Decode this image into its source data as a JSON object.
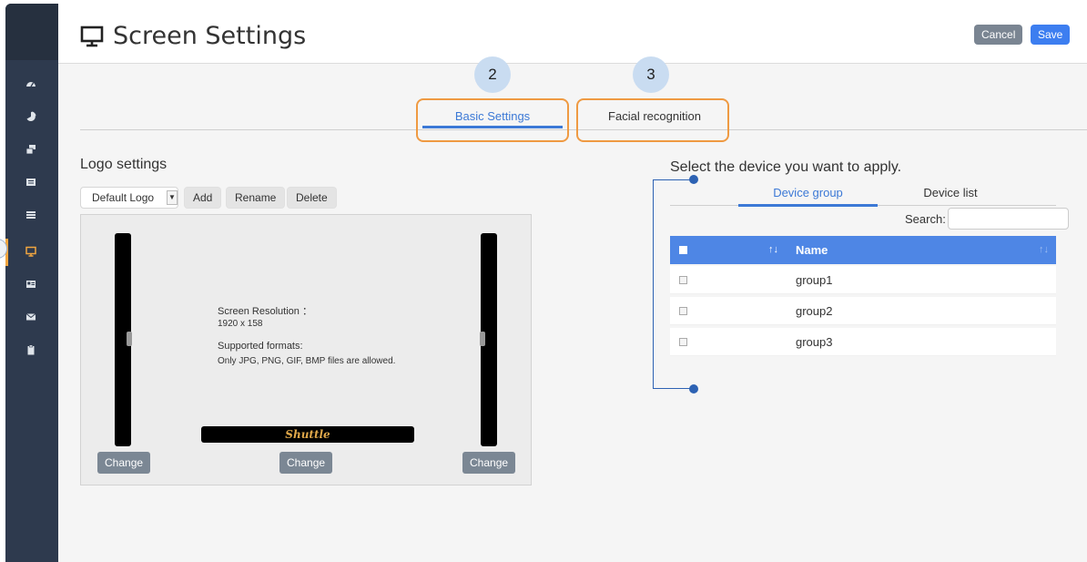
{
  "header": {
    "title": "Screen Settings",
    "cancel_label": "Cancel",
    "save_label": "Save"
  },
  "steps": {
    "two": "2",
    "three": "3"
  },
  "tabs": {
    "basic": "Basic Settings",
    "facial": "Facial recognition"
  },
  "logo_settings": {
    "title": "Logo settings",
    "dropdown_value": "Default Logo",
    "add_label": "Add",
    "rename_label": "Rename",
    "delete_label": "Delete",
    "resolution_title": "Screen Resolution ：",
    "resolution_value": "1920 x 158",
    "formats_title": "Supported formats:",
    "formats_value": "Only JPG, PNG, GIF, BMP files are allowed.",
    "logo_text": "Shuttle",
    "change_label": "Change"
  },
  "device": {
    "title": "Select the device you want to apply.",
    "tab_group": "Device group",
    "tab_list": "Device list",
    "search_label": "Search:",
    "column_sort_glyph": "↑↓",
    "column_name": "Name",
    "rows": [
      "group1",
      "group2",
      "group3"
    ]
  },
  "colors": {
    "accent": "#3c79d6",
    "highlight": "#ef9a42",
    "sidebar": "#2e3a4e"
  }
}
